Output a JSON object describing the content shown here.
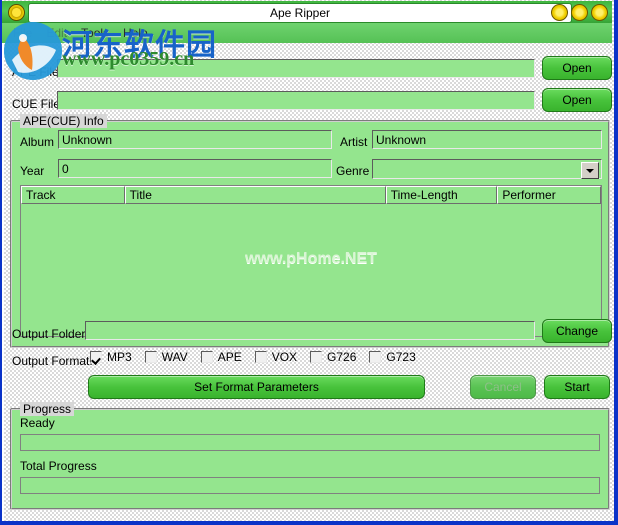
{
  "window": {
    "title": "Ape Ripper",
    "app_icon": "disc-icon",
    "controls": [
      {
        "name": "minimize-button",
        "icon": "minimize-icon"
      },
      {
        "name": "maximize-button",
        "icon": "maximize-icon"
      },
      {
        "name": "close-button",
        "icon": "close-icon"
      }
    ]
  },
  "menu": {
    "items": [
      {
        "label": "File",
        "enabled": false
      },
      {
        "label": "Edit",
        "enabled": false
      },
      {
        "label": "Tools",
        "enabled": true
      },
      {
        "label": "Help",
        "enabled": true
      }
    ]
  },
  "files": {
    "ape_label": "APE File",
    "ape_value": "",
    "ape_open_label": "Open",
    "cue_label": "CUE File",
    "cue_value": "",
    "cue_open_label": "Open"
  },
  "info": {
    "group_title": "APE(CUE) Info",
    "album_label": "Album",
    "album_value": "Unknown",
    "artist_label": "Artist",
    "artist_value": "Unknown",
    "year_label": "Year",
    "year_value": "0",
    "genre_label": "Genre",
    "genre_value": "",
    "table": {
      "columns": [
        "Track",
        "Title",
        "Time-Length",
        "Performer"
      ],
      "rows": [],
      "watermark": "www.pHome.NET"
    }
  },
  "output": {
    "folder_label": "Output Folder",
    "folder_value": "",
    "change_label": "Change",
    "format_label": "Output Format:",
    "formats": [
      {
        "label": "MP3",
        "checked": true
      },
      {
        "label": "WAV",
        "checked": false
      },
      {
        "label": "APE",
        "checked": false
      },
      {
        "label": "VOX",
        "checked": false
      },
      {
        "label": "G726",
        "checked": false
      },
      {
        "label": "G723",
        "checked": false
      }
    ]
  },
  "actions": {
    "set_format_label": "Set Format Parameters",
    "cancel_label": "Cancel",
    "cancel_enabled": false,
    "start_label": "Start",
    "start_enabled": true
  },
  "progress": {
    "group_title": "Progress",
    "status_text": "Ready",
    "current_percent": 0,
    "total_label": "Total Progress",
    "total_percent": 0
  },
  "watermarks": {
    "site_name_cn": "河东软件园",
    "site_url": "www.pc0359.cn"
  },
  "colors": {
    "desktop": "#0a33c8",
    "titlebar_green": "#57c957",
    "field_green": "#94e58e",
    "button_green": "#48c33c",
    "watermark_blue": "#1763c8",
    "watermark_green": "#2e8b2e"
  }
}
